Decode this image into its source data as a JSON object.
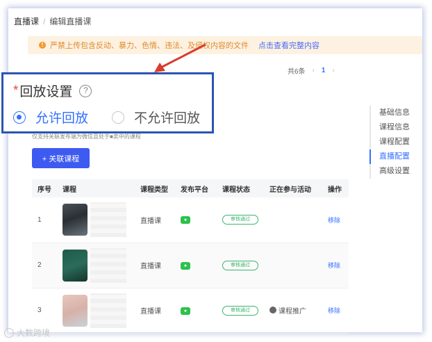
{
  "breadcrumb": {
    "root": "直播课",
    "separator": "/",
    "current": "编辑直播课"
  },
  "notice": {
    "text": "严禁上传包含反动、暴力、色情、违法、及侵权内容的文件",
    "link": "点击查看完整内容",
    "icon": "!"
  },
  "pager": {
    "total": "共6条",
    "prev": "‹",
    "page": "1",
    "next": "›"
  },
  "replay": {
    "required_mark": "*",
    "title": "回放设置",
    "help": "?",
    "option_allow": "允许回放",
    "option_deny": "不允许回放",
    "selected": "allow"
  },
  "hint": "仅支持关联发布端为微信且处于■卖中的课程",
  "link_button": "+ 关联课程",
  "sidenav": {
    "items": [
      {
        "label": "基础信息"
      },
      {
        "label": "课程信息"
      },
      {
        "label": "课程配置"
      },
      {
        "label": "直播配置",
        "active": true
      },
      {
        "label": "高级设置"
      }
    ]
  },
  "table": {
    "headers": [
      "序号",
      "课程",
      "课程类型",
      "发布平台",
      "课程状态",
      "正在参与活动",
      "操作"
    ],
    "rows": [
      {
        "index": "1",
        "type": "直播课",
        "platform": "wechat",
        "status": "审核通过",
        "activity": "",
        "action": "移除"
      },
      {
        "index": "2",
        "type": "直播课",
        "platform": "wechat",
        "status": "审核通过",
        "activity": "",
        "action": "移除"
      },
      {
        "index": "3",
        "type": "直播课",
        "platform": "wechat",
        "status": "审核通过",
        "activity": "课程推广",
        "action": "移除"
      }
    ]
  },
  "watermark": "大数跨境",
  "colors": {
    "primary": "#3370ff",
    "button": "#3d5af1",
    "success": "#3bb46e",
    "highlight_border": "#2b55b0",
    "arrow": "#d93c2f"
  }
}
